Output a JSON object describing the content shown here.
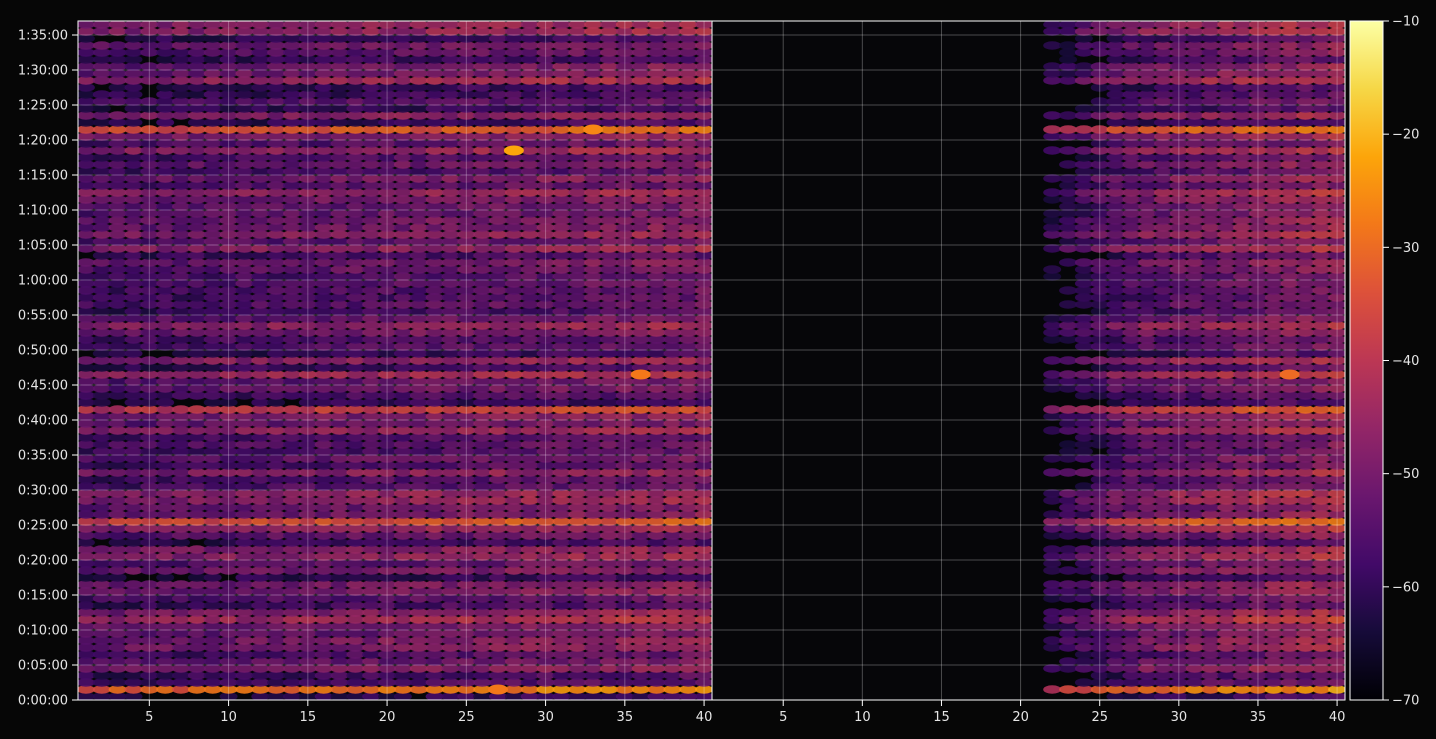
{
  "chart_data": {
    "type": "heatmap",
    "layout_note": "two side-by-side heatmap panels sharing one y-axis (time) and one colorbar",
    "y_axis": {
      "ticks": [
        "0:00:00",
        "0:05:00",
        "0:10:00",
        "0:15:00",
        "0:20:00",
        "0:25:00",
        "0:30:00",
        "0:35:00",
        "0:40:00",
        "0:45:00",
        "0:50:00",
        "0:55:00",
        "1:00:00",
        "1:05:00",
        "1:10:00",
        "1:15:00",
        "1:20:00",
        "1:25:00",
        "1:30:00",
        "1:35:00"
      ],
      "range_minutes": [
        0,
        97
      ]
    },
    "panels": [
      {
        "name": "left",
        "x_ticks": [
          "5",
          "10",
          "15",
          "20",
          "25",
          "30",
          "35",
          "40"
        ],
        "x_range": [
          1,
          40
        ],
        "fill_band": [
          1,
          40
        ]
      },
      {
        "name": "right",
        "x_ticks": [
          "5",
          "10",
          "15",
          "20",
          "25",
          "30",
          "35",
          "40"
        ],
        "x_range": [
          1,
          40
        ],
        "fill_band": [
          22,
          40
        ]
      }
    ],
    "colorbar": {
      "colormap": "inferno",
      "range": [
        -70,
        -10
      ],
      "ticks": [
        "−10",
        "−20",
        "−30",
        "−40",
        "−50",
        "−60",
        "−70"
      ]
    },
    "hot_spots": [
      {
        "panel": "left",
        "x": 36,
        "t_min": 46,
        "value": -28
      },
      {
        "panel": "right",
        "x": 37,
        "t_min": 46,
        "value": -30
      },
      {
        "panel": "left",
        "x": 28,
        "t_min": 78,
        "value": -22
      },
      {
        "panel": "left",
        "x": 33,
        "t_min": 81,
        "value": -26
      },
      {
        "panel": "left",
        "x": 27,
        "t_min": 1,
        "value": -28
      }
    ],
    "grid": true,
    "colors": {
      "background": "#060606",
      "frame": "#ffffff",
      "text": "#e6e6e6"
    }
  }
}
